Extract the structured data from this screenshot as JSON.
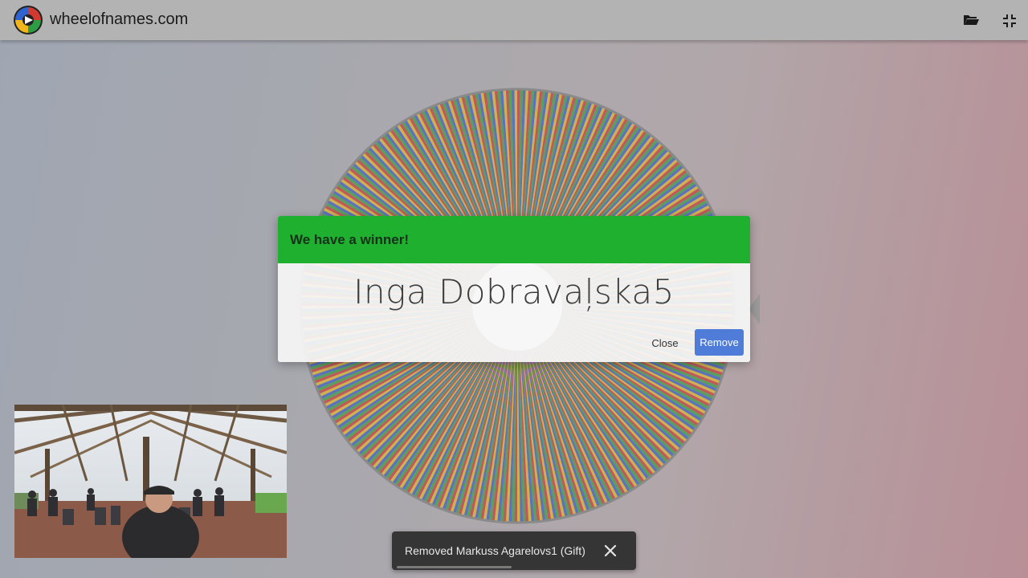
{
  "header": {
    "site_name": "wheelofnames.com",
    "icons": [
      "wheel-logo-icon",
      "folder-open-icon",
      "fullscreen-exit-icon"
    ]
  },
  "wheel": {
    "segment_colors": [
      "#cf2f2f",
      "#2f9a35",
      "#3455c9",
      "#e6b520"
    ],
    "center_color": "#ffffff"
  },
  "dialog": {
    "header_title": "We have a winner!",
    "winner_name": "Inga Dobravaļska5",
    "close_label": "Close",
    "remove_label": "Remove",
    "header_color": "#1fb030",
    "remove_color": "#4f7cd8"
  },
  "toast": {
    "message": "Removed Markuss Agarelovs1 (Gift)",
    "close_icon": "close-icon",
    "progress": 0.49
  }
}
